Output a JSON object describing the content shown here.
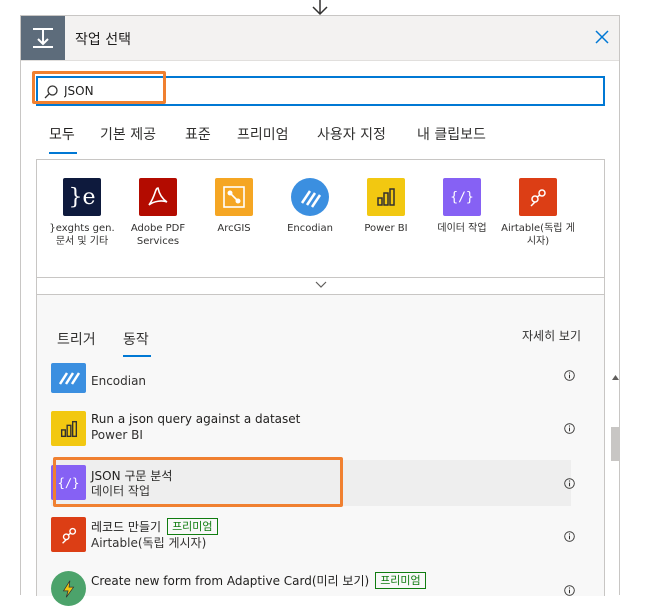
{
  "dialog": {
    "title": "작업 선택",
    "close_icon": "close-icon",
    "header_icon": "import-action-icon"
  },
  "search": {
    "value": "JSON",
    "icon": "search-icon"
  },
  "tabs": [
    {
      "label": "모두",
      "active": true
    },
    {
      "label": "기본 제공"
    },
    {
      "label": "표준"
    },
    {
      "label": "프리미엄"
    },
    {
      "label": "사용자 지정"
    },
    {
      "label": "내 클립보드"
    }
  ],
  "connectors": [
    {
      "label": "}exghts gen. 문서 및 기타",
      "color": "#0e1a3d",
      "icon": "encodian-flowr-logo-icon"
    },
    {
      "label": "Adobe PDF Services",
      "color": "#b30b00",
      "icon": "adobe-pdf-logo-icon"
    },
    {
      "label": "ArcGIS",
      "color": "#f5a623",
      "icon": "arcgis-logo-icon"
    },
    {
      "label": "Encodian",
      "color": "#3b8fe0",
      "icon": "encodian-logo-icon"
    },
    {
      "label": "Power BI",
      "color": "#f2c811",
      "icon": "power-bi-logo-icon"
    },
    {
      "label": "데이터 작업",
      "color": "#8661f4",
      "icon": "data-operation-logo-icon"
    },
    {
      "label": "Airtable(독립 게시자)",
      "color": "#dc3e15",
      "icon": "airtable-logo-icon"
    }
  ],
  "results": {
    "tabs": [
      {
        "label": "트리거"
      },
      {
        "label": "동작",
        "active": true
      }
    ],
    "see_more": "자세히 보기",
    "actions": [
      {
        "title": "",
        "subtitle": "Encodian",
        "color": "#3b8fe0",
        "icon": "encodian-logo-icon"
      },
      {
        "title": "Run a json query against a dataset",
        "subtitle": "Power BI",
        "color": "#f2c811",
        "icon": "power-bi-logo-icon"
      },
      {
        "title": "JSON 구문 분석",
        "subtitle": "데이터 작업",
        "color": "#8661f4",
        "icon": "data-operation-logo-icon",
        "selected": true
      },
      {
        "title": "레코드 만들기",
        "subtitle": "Airtable(독립 게시자)",
        "color": "#dc3e15",
        "icon": "airtable-logo-icon",
        "premium": "프리미엄"
      },
      {
        "title": "Create new form from Adaptive Card(미리 보기)",
        "subtitle": "",
        "color": "#4ca36b",
        "icon": "adaptive-card-logo-icon",
        "premium": "프리미엄"
      }
    ]
  },
  "colors": {
    "accent": "#0078d4",
    "highlight": "#f08030",
    "premium": "#107c10"
  }
}
